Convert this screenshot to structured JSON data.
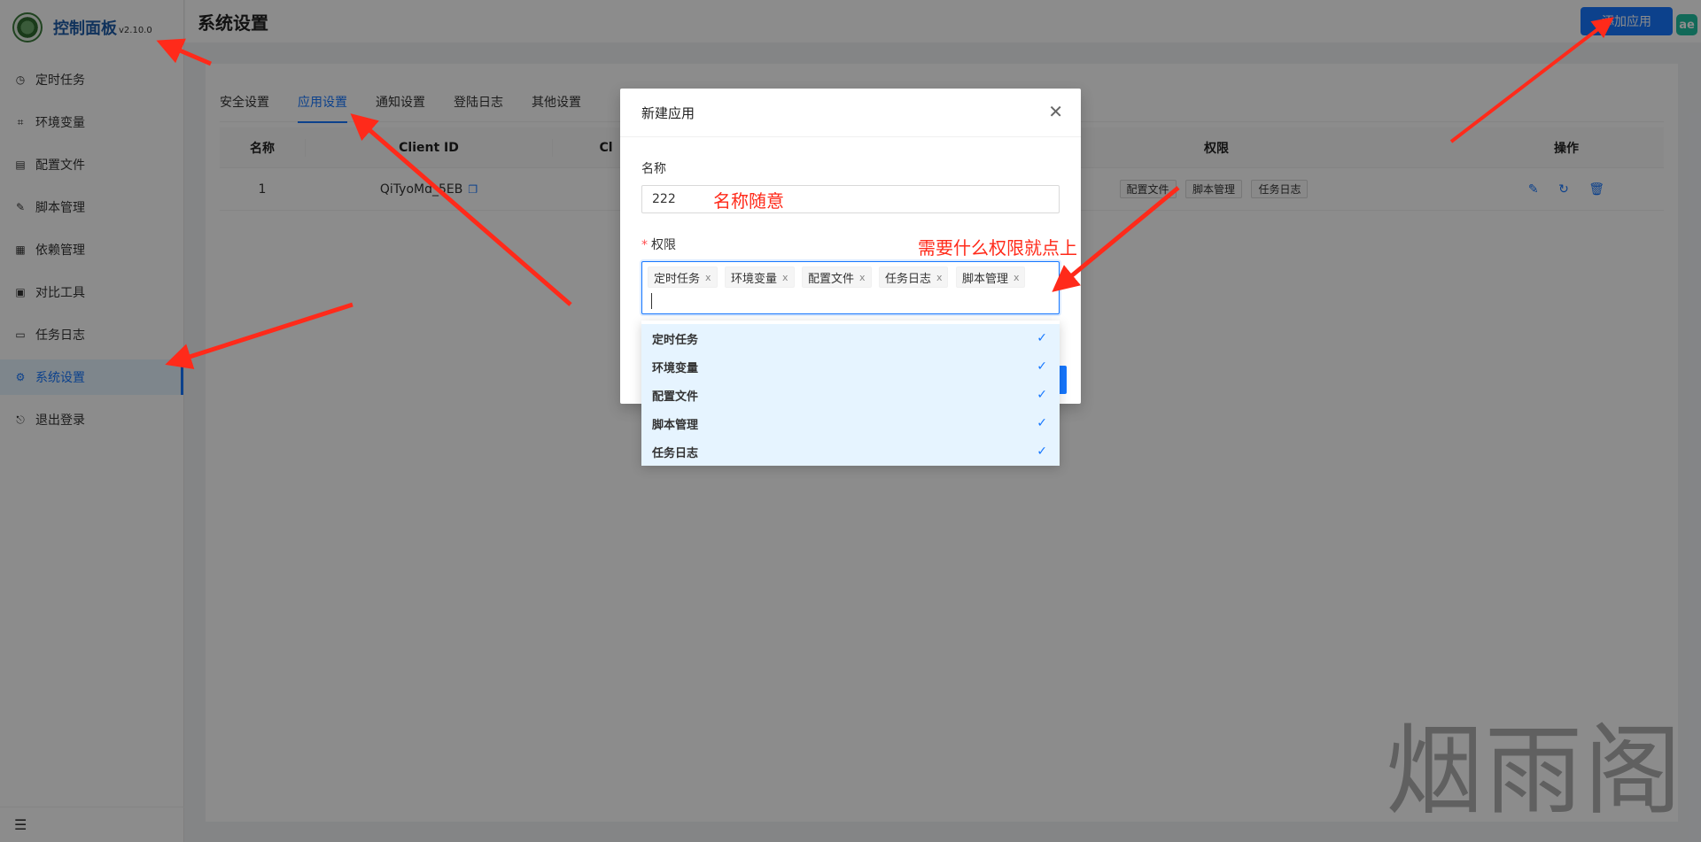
{
  "logo": {
    "title": "控制面板",
    "version": "v2.10.0"
  },
  "sidebar": {
    "items": [
      {
        "label": "定时任务",
        "icon": "clock-icon"
      },
      {
        "label": "环境变量",
        "icon": "variable-icon"
      },
      {
        "label": "配置文件",
        "icon": "config-icon"
      },
      {
        "label": "脚本管理",
        "icon": "edit-icon"
      },
      {
        "label": "依赖管理",
        "icon": "package-icon"
      },
      {
        "label": "对比工具",
        "icon": "diff-icon"
      },
      {
        "label": "任务日志",
        "icon": "folder-icon"
      },
      {
        "label": "系统设置",
        "icon": "gear-icon",
        "active": true
      },
      {
        "label": "退出登录",
        "icon": "logout-icon"
      }
    ]
  },
  "header": {
    "title": "系统设置",
    "add_button": "添加应用",
    "badge": "ae"
  },
  "tabs": [
    "安全设置",
    "应用设置",
    "通知设置",
    "登陆日志",
    "其他设置"
  ],
  "table": {
    "headers": {
      "name": "名称",
      "client_id": "Client ID",
      "client_secret": "Cl",
      "permissions": "权限",
      "actions": "操作"
    },
    "rows": [
      {
        "name": "1",
        "client_id": "QiTyoMd_5EB",
        "permissions": [
          "配置文件",
          "脚本管理",
          "任务日志"
        ]
      }
    ]
  },
  "modal": {
    "title": "新建应用",
    "name_label": "名称",
    "name_value": "222",
    "perm_label": "权限",
    "selected": [
      "定时任务",
      "环境变量",
      "配置文件",
      "任务日志",
      "脚本管理"
    ]
  },
  "dropdown": {
    "options": [
      "定时任务",
      "环境变量",
      "配置文件",
      "脚本管理",
      "任务日志"
    ]
  },
  "annotations": {
    "name_note": "名称随意",
    "perm_note": "需要什么权限就点上",
    "color": "#ff2a1a"
  },
  "watermark": "烟雨阁",
  "colors": {
    "primary": "#1677ff",
    "brand": "#1e5ca8"
  }
}
